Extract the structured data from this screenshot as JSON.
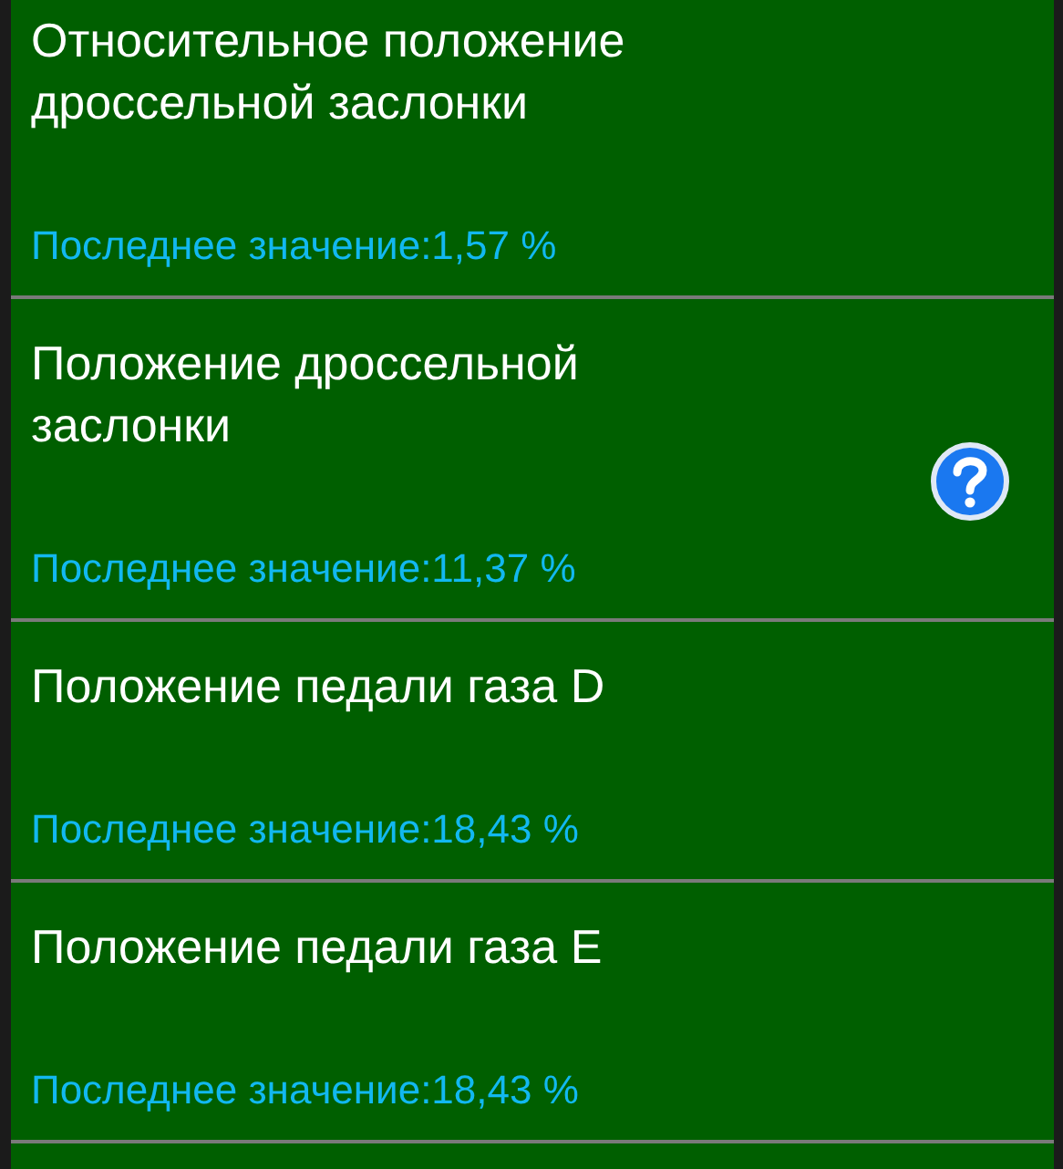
{
  "parameters": [
    {
      "title": "Относительное положение дроссельной заслонки",
      "value": "Последнее значение:1,57 %",
      "help": false
    },
    {
      "title": "Положение дроссельной заслонки",
      "value": "Последнее значение:11,37 %",
      "help": true
    },
    {
      "title": "Положение педали газа D",
      "value": "Последнее значение:18,43 %",
      "help": false
    },
    {
      "title": "Положение педали газа E",
      "value": "Последнее значение:18,43 %",
      "help": false
    }
  ]
}
